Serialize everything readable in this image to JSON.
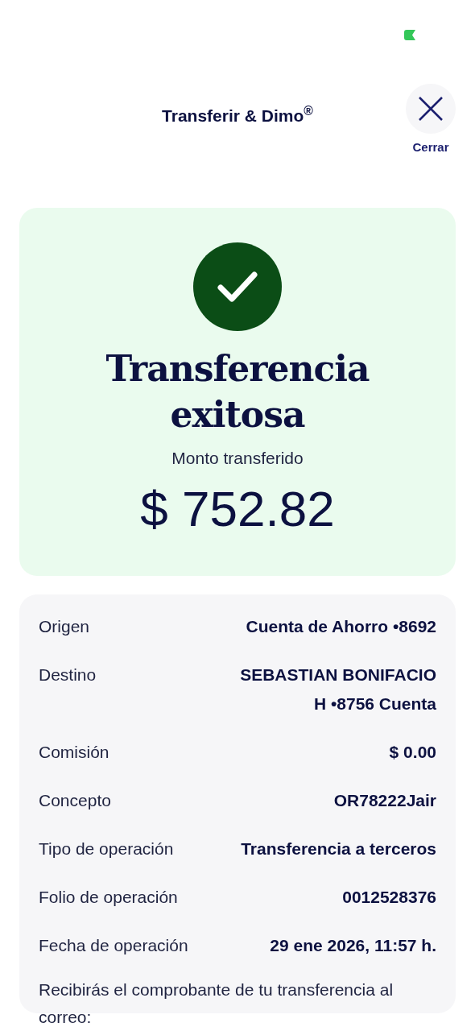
{
  "header": {
    "title": "Transferir & Dimo$^{®}$",
    "close_label": "Cerrar"
  },
  "result": {
    "title": "Transferencia exitosa",
    "amount_label": "Monto transferido",
    "amount": "$ 752.82"
  },
  "details": [
    {
      "label": "Origen",
      "value": "Cuenta de Ahorro •8692"
    },
    {
      "label": "Destino",
      "value": "SEBASTIAN BONIFACIO H •8756 Cuenta"
    },
    {
      "label": "Comisión",
      "value": "$ 0.00"
    },
    {
      "label": "Concepto",
      "value": "OR78222Jair"
    },
    {
      "label": "Tipo de operación",
      "value": "Transferencia a terceros"
    },
    {
      "label": "Folio de operación",
      "value": "0012528376"
    },
    {
      "label": "Fecha de operación",
      "value": "29 ene 2026, 11:57 h."
    }
  ],
  "note": "Recibirás el comprobante de tu transferencia al correo:"
}
